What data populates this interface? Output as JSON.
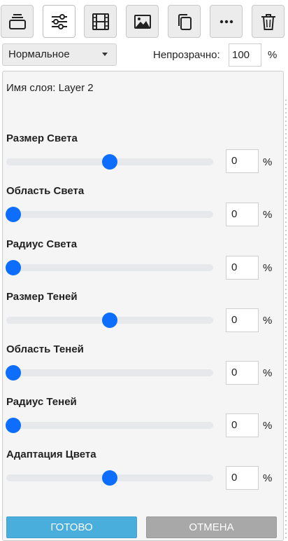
{
  "toolbar": {
    "icons": [
      "layers-icon",
      "sliders-icon",
      "film-icon",
      "image-icon",
      "copy-icon",
      "more-icon",
      "trash-icon"
    ],
    "active": "sliders-icon"
  },
  "blend": {
    "selected": "Нормальное"
  },
  "opacity": {
    "label": "Непрозрачно:",
    "value": "100",
    "unit": "%"
  },
  "layer": {
    "name_text": "Имя слоя: Layer 2"
  },
  "params": [
    {
      "label": "Размер Света",
      "value": "0",
      "unit": "%",
      "level": 0.5
    },
    {
      "label": "Область Света",
      "value": "0",
      "unit": "%",
      "level": 0.0
    },
    {
      "label": "Радиус Света",
      "value": "0",
      "unit": "%",
      "level": 0.0
    },
    {
      "label": "Размер Теней",
      "value": "0",
      "unit": "%",
      "level": 0.5
    },
    {
      "label": "Область Теней",
      "value": "0",
      "unit": "%",
      "level": 0.0
    },
    {
      "label": "Радиус Теней",
      "value": "0",
      "unit": "%",
      "level": 0.0
    },
    {
      "label": "Адаптация Цвета",
      "value": "0",
      "unit": "%",
      "level": 0.5
    }
  ],
  "actions": {
    "done": "ГОТОВО",
    "cancel": "ОТМЕНА"
  },
  "colors": {
    "accent": "#0d6efd",
    "done": "#4aaedc",
    "cancel": "#a8a8a8"
  }
}
